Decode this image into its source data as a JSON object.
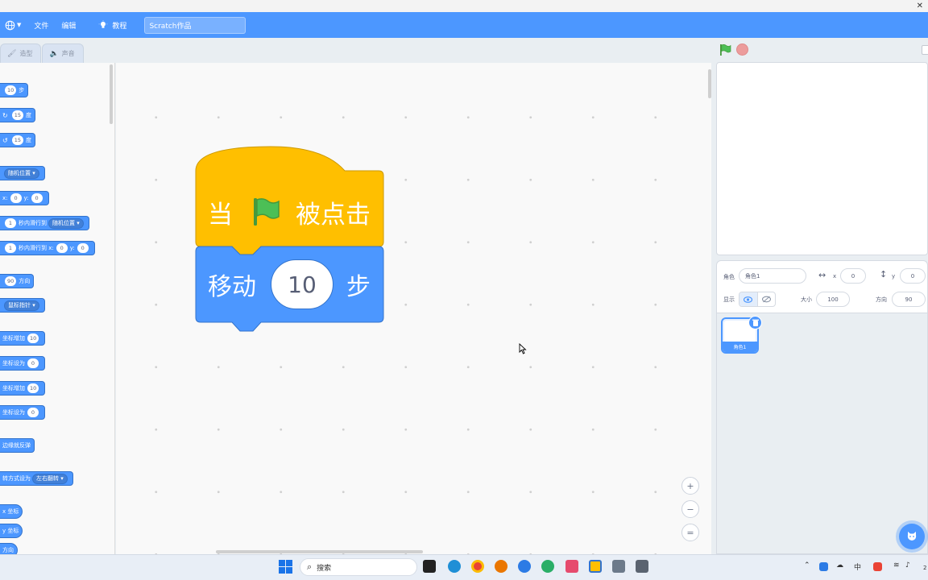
{
  "window": {
    "close_glyph": "✕"
  },
  "menubar": {
    "globe_icon": "globe-icon",
    "file": "文件",
    "edit": "编辑",
    "tutorials": "教程",
    "project_title": "Scratch作品"
  },
  "tabs": {
    "costumes": "造型",
    "sounds": "声音"
  },
  "palette": {
    "move_val": "10",
    "move_unit": "步",
    "turn_right_val": "15",
    "turn_left_val": "15",
    "degrees": "度",
    "goto_random": "随机位置",
    "goto_x_label": "x:",
    "goto_x_val": "0",
    "goto_y_label": "y:",
    "goto_y_val": "0",
    "glide_val": "1",
    "glide_to": "秒内滑行到",
    "glide_target": "随机位置",
    "glide_xy_val": "1",
    "glide_xy_text": "秒内滑行到 x:",
    "glide_xy_x": "0",
    "glide_xy_y_label": "y:",
    "glide_xy_y": "0",
    "dir_val": "90",
    "dir_text": "方向",
    "point_towards": "鼠标指针",
    "change_x": "坐标增加",
    "change_x_val": "10",
    "set_x": "坐标设为",
    "set_x_val": "0",
    "change_y": "坐标增加",
    "change_y_val": "10",
    "set_y": "坐标设为",
    "set_y_val": "0",
    "bounce": "边缘就反弹",
    "rotation_style": "转方式设为",
    "rotation_value": "左右翻转",
    "x_pos": "x 坐标",
    "y_pos": "y 坐标",
    "direction": "方向"
  },
  "script": {
    "hat_when": "当",
    "hat_clicked": "被点击",
    "move_label": "移动",
    "move_steps": "10",
    "move_unit": "步"
  },
  "zoom": {
    "in": "+",
    "out": "−",
    "reset": "="
  },
  "sprite_info": {
    "sprite_label": "角色",
    "sprite_name": "角色1",
    "x_label": "x",
    "x_value": "0",
    "y_label": "y",
    "y_value": "0",
    "show_label": "显示",
    "size_label": "大小",
    "size_value": "100",
    "direction_label": "方向",
    "direction_value": "90"
  },
  "sprites": [
    {
      "name": "角色1"
    }
  ],
  "taskbar": {
    "search": "搜索",
    "ime": "中",
    "clock": "2"
  },
  "colors": {
    "motion": "#4c97ff",
    "events": "#ffbf00",
    "menubar": "#4c97ff",
    "workspace": "#f9f9f9",
    "green_flag": "#4cbf56",
    "stop": "#ec9c9c"
  }
}
